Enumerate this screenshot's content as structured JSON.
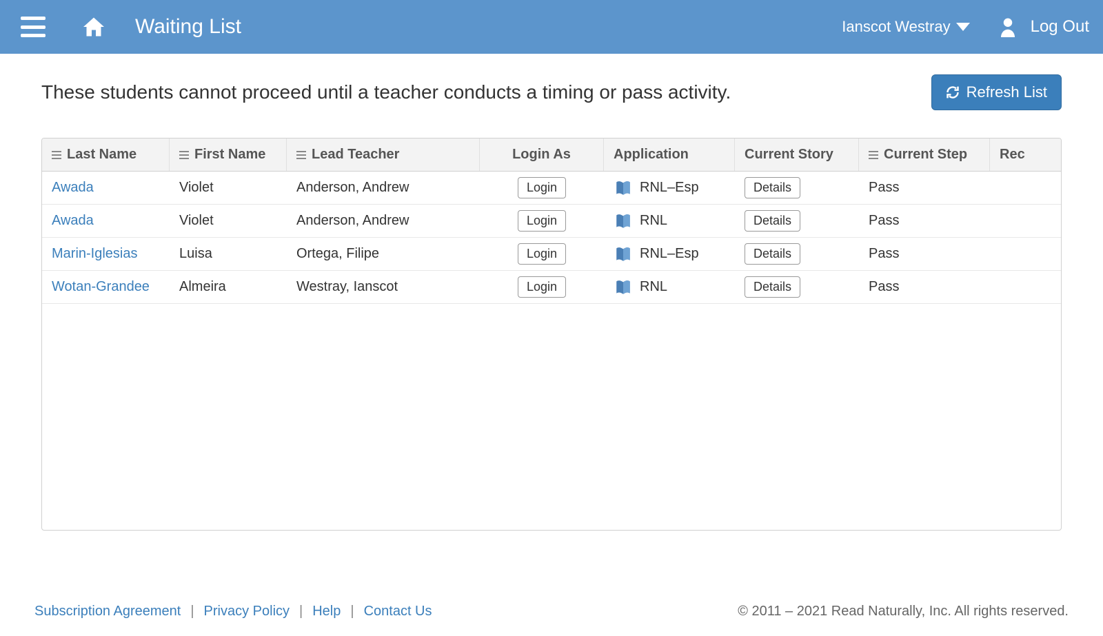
{
  "header": {
    "page_title": "Waiting List",
    "user_name": "Ianscot Westray",
    "logout_label": "Log Out"
  },
  "main": {
    "subtitle": "These students cannot proceed until a teacher conducts a timing or pass activity.",
    "refresh_label": "Refresh List"
  },
  "table": {
    "columns": [
      "Last Name",
      "First Name",
      "Lead Teacher",
      "Login As",
      "Application",
      "Current Story",
      "Current Step",
      "Rec"
    ],
    "login_button_label": "Login",
    "details_button_label": "Details",
    "rows": [
      {
        "last": "Awada",
        "first": "Violet",
        "teacher": "Anderson, Andrew",
        "app": "RNL–Esp",
        "step": "Pass"
      },
      {
        "last": "Awada",
        "first": "Violet",
        "teacher": "Anderson, Andrew",
        "app": "RNL",
        "step": "Pass"
      },
      {
        "last": "Marin-Iglesias",
        "first": "Luisa",
        "teacher": "Ortega, Filipe",
        "app": "RNL–Esp",
        "step": "Pass"
      },
      {
        "last": "Wotan-Grandee",
        "first": "Almeira",
        "teacher": "Westray, Ianscot",
        "app": "RNL",
        "step": "Pass"
      }
    ]
  },
  "footer": {
    "links": [
      "Subscription Agreement",
      "Privacy Policy",
      "Help",
      "Contact Us"
    ],
    "copyright": "© 2011 – 2021 Read Naturally, Inc. All rights reserved."
  }
}
